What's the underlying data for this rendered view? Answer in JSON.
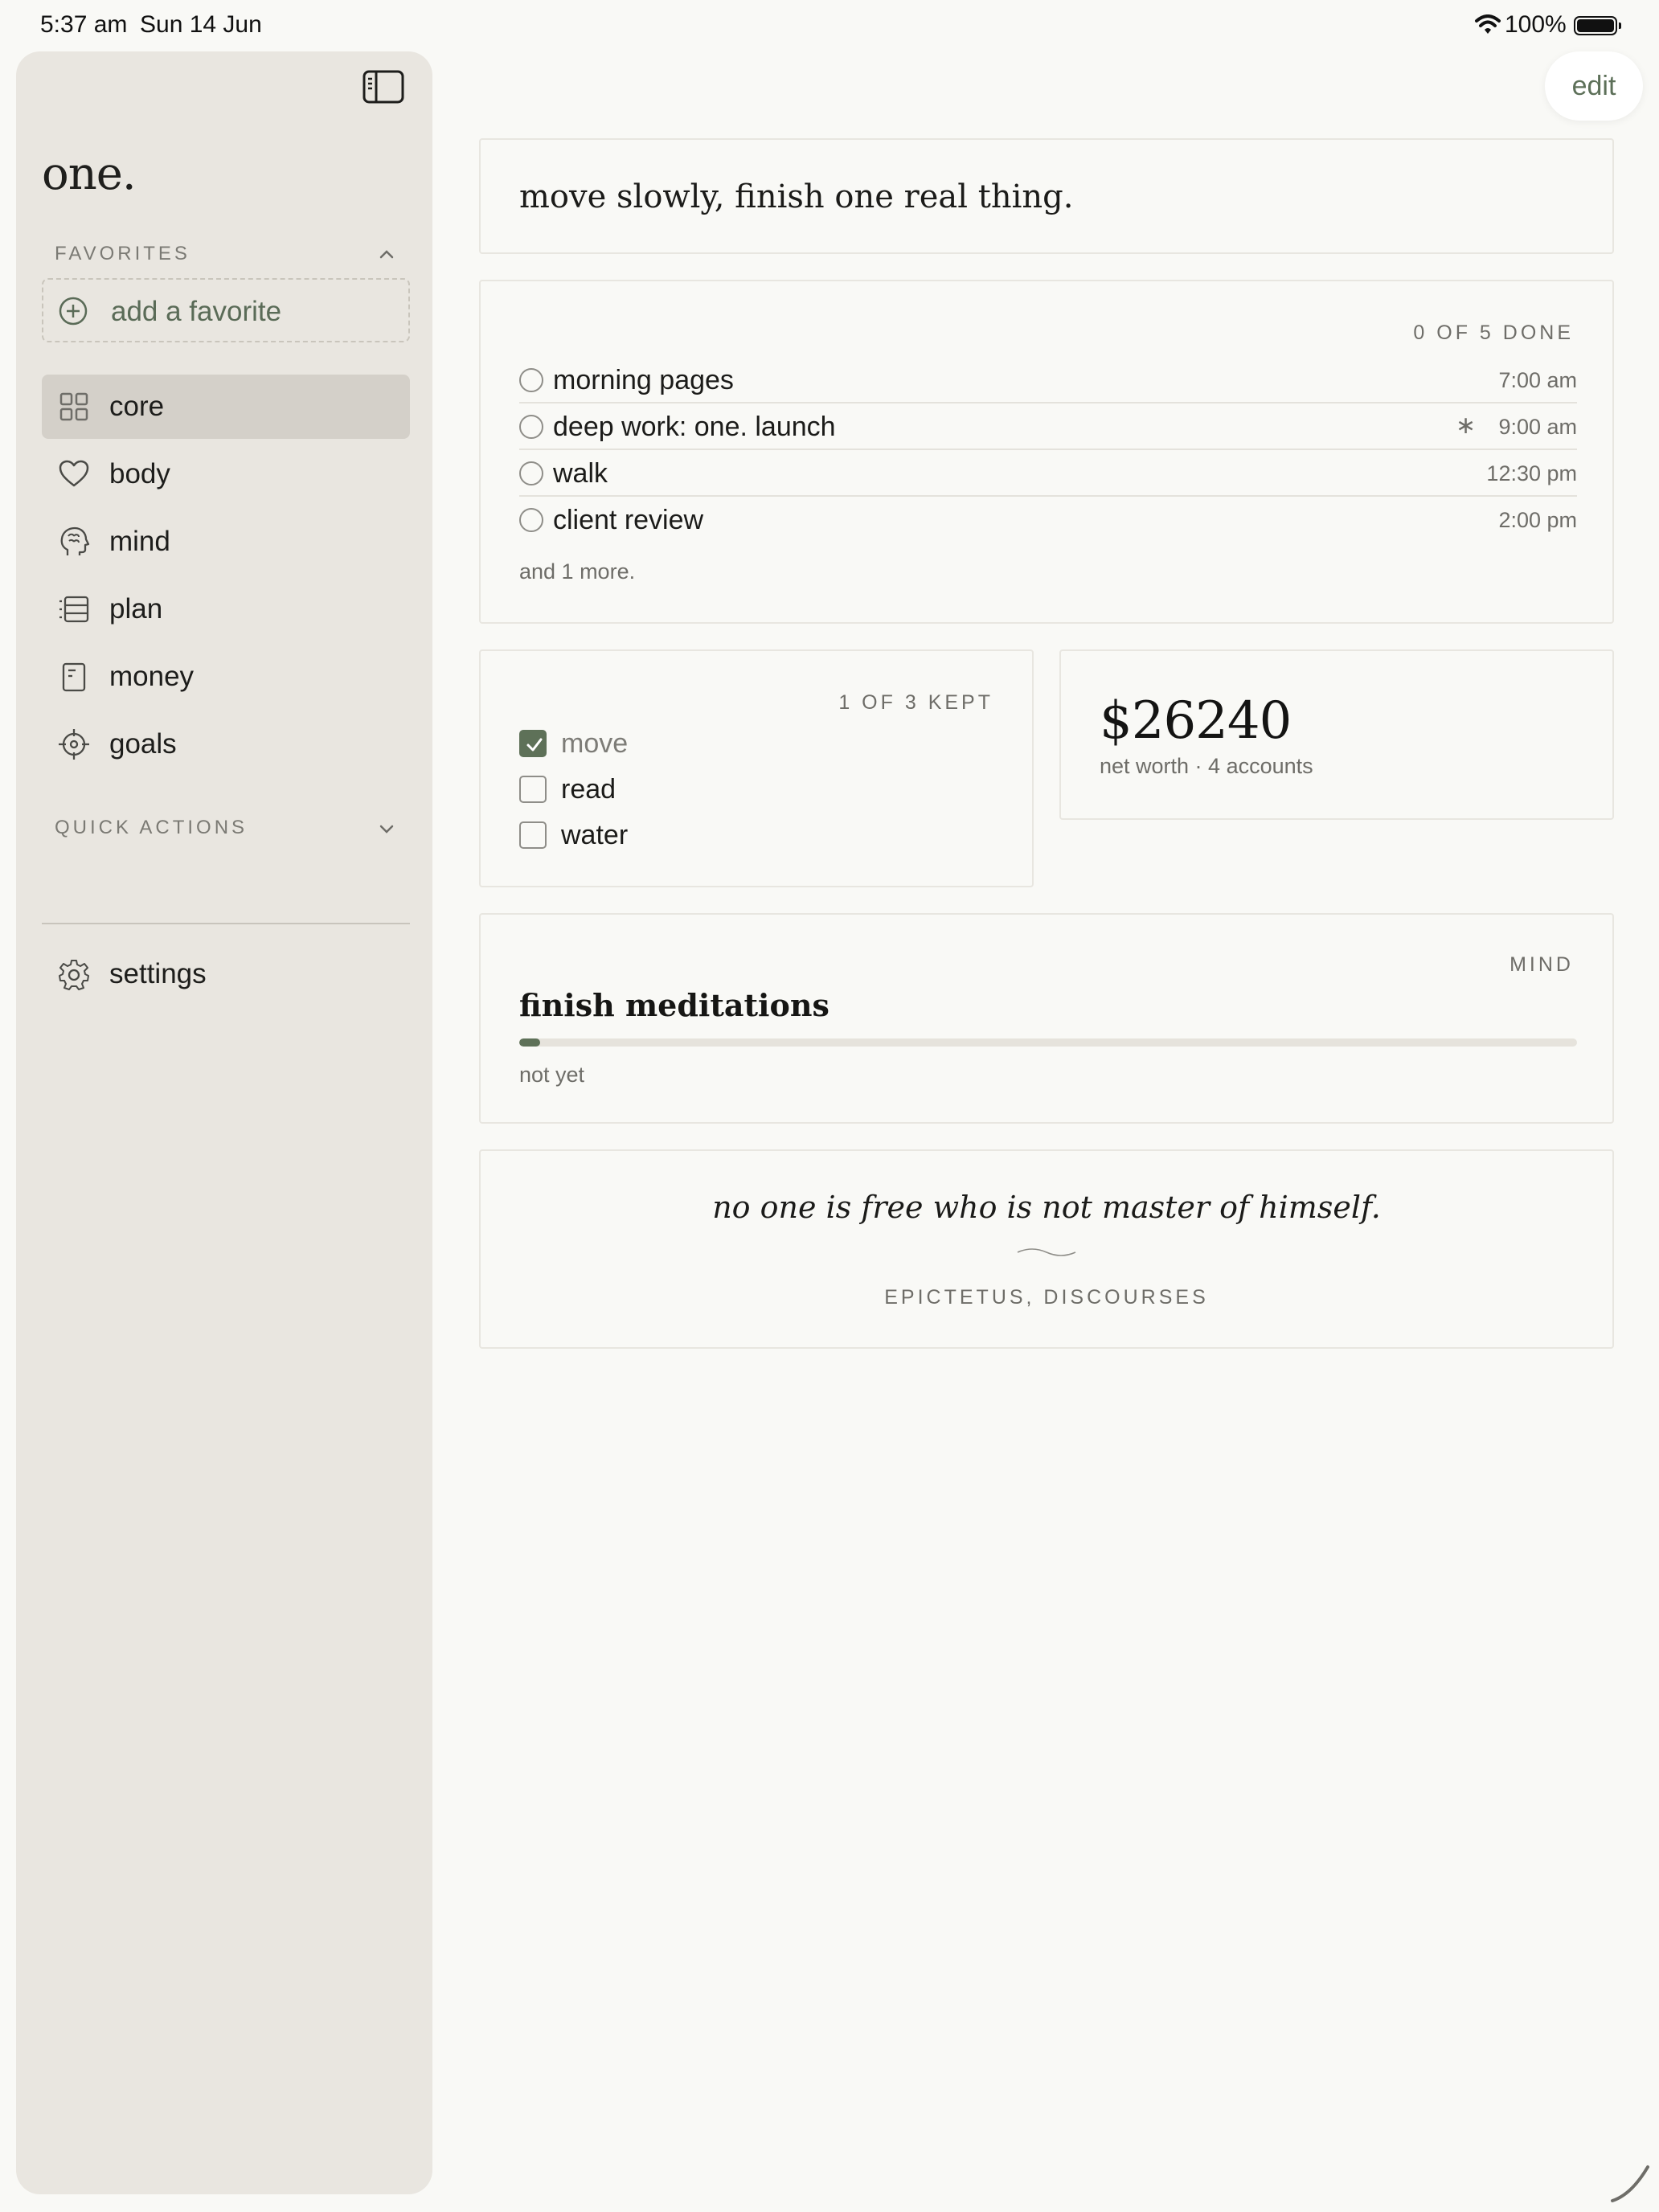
{
  "status_bar": {
    "time": "5:37 am",
    "date": "Sun 14 Jun",
    "battery": "100%"
  },
  "sidebar": {
    "app_title": "one.",
    "favorites_header": "FAVORITES",
    "add_favorite": "add a favorite",
    "nav": [
      {
        "label": "core",
        "icon": "grid-icon",
        "active": true
      },
      {
        "label": "body",
        "icon": "heart-icon"
      },
      {
        "label": "mind",
        "icon": "brain-icon"
      },
      {
        "label": "plan",
        "icon": "list-icon"
      },
      {
        "label": "money",
        "icon": "receipt-icon"
      },
      {
        "label": "goals",
        "icon": "crosshair-icon"
      }
    ],
    "quick_actions_header": "QUICK ACTIONS",
    "settings": "settings"
  },
  "toolbar": {
    "edit_label": "edit"
  },
  "intention": "move slowly, finish one real thing.",
  "tasks": {
    "summary": "0 OF 5 DONE",
    "items": [
      {
        "label": "morning pages",
        "time": "7:00 am"
      },
      {
        "label": "deep work: one. launch",
        "time": "9:00 am",
        "marker": "∗"
      },
      {
        "label": "walk",
        "time": "12:30 pm"
      },
      {
        "label": "client review",
        "time": "2:00 pm"
      }
    ],
    "more": "and 1 more."
  },
  "habits": {
    "summary": "1 OF 3 KEPT",
    "items": [
      {
        "label": "move",
        "checked": true
      },
      {
        "label": "read",
        "checked": false
      },
      {
        "label": "water",
        "checked": false
      }
    ]
  },
  "money": {
    "net_worth": "$26240",
    "subtitle": "net worth · 4 accounts"
  },
  "goal": {
    "category": "MIND",
    "title": "finish meditations",
    "progress": 0.02,
    "status": "not yet"
  },
  "quote": {
    "text": "no one is free who is not master of himself.",
    "attribution": "EPICTETUS, DISCOURSES"
  },
  "colors": {
    "accent": "#5e7158",
    "sidebar_bg": "#e9e6e0",
    "page_bg": "#f9f9f6"
  }
}
